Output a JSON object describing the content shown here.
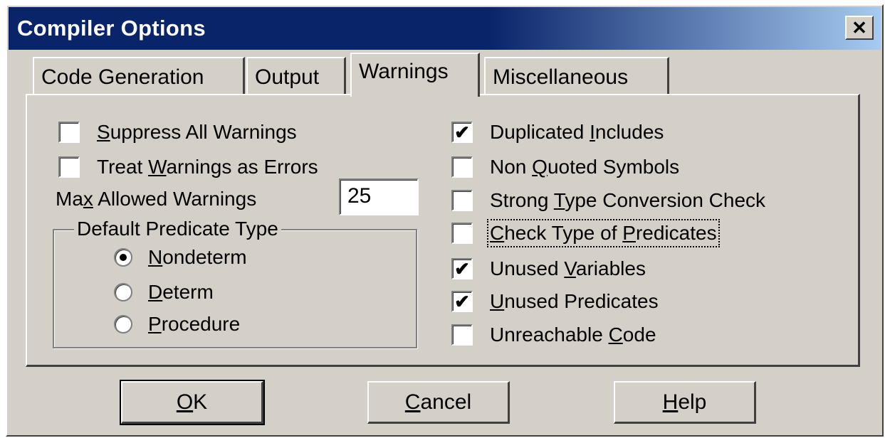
{
  "window": {
    "title": "Compiler Options",
    "close_symbol": "✕"
  },
  "tabs": [
    {
      "label": "Code Generation",
      "active": false
    },
    {
      "label": "Output",
      "active": false
    },
    {
      "label": "Warnings",
      "active": true
    },
    {
      "label": "Miscellaneous",
      "active": false
    }
  ],
  "left_options": {
    "suppress_all": {
      "pre": "",
      "u": "S",
      "post": "uppress All Warnings",
      "checked": false
    },
    "treat_as_errors": {
      "pre": "Treat ",
      "u": "W",
      "post": "arnings as Errors",
      "checked": false
    },
    "max_allowed": {
      "pre": "Ma",
      "u": "x",
      "post": " Allowed Warnings",
      "value": "25"
    }
  },
  "predicate_group": {
    "legend": "Default Predicate Type",
    "options": [
      {
        "u": "N",
        "post": "ondeterm",
        "selected": true
      },
      {
        "u": "D",
        "post": "eterm",
        "selected": false
      },
      {
        "u": "P",
        "post": "rocedure",
        "selected": false
      }
    ]
  },
  "right_options": [
    {
      "pre": "Duplicated ",
      "u": "I",
      "post": "ncludes",
      "checked": true
    },
    {
      "pre": "Non ",
      "u": "Q",
      "post": "uoted Symbols",
      "checked": false
    },
    {
      "pre": "Strong ",
      "u": "T",
      "post": "ype Conversion Check",
      "checked": false
    },
    {
      "pre": "",
      "u": "C",
      "post": "heck Type of ",
      "u2": "P",
      "post2": "redicates",
      "checked": false,
      "focused": true
    },
    {
      "pre": "Unused ",
      "u": "V",
      "post": "ariables",
      "checked": true
    },
    {
      "pre": "",
      "u": "U",
      "post": "nused Predicates",
      "checked": true
    },
    {
      "pre": "Unreachable ",
      "u": "C",
      "post": "ode",
      "checked": false
    }
  ],
  "buttons": {
    "ok": {
      "u": "O",
      "post": "K"
    },
    "cancel": {
      "u": "C",
      "post": "ancel"
    },
    "help": {
      "u": "H",
      "post": "elp"
    }
  },
  "check_mark": "✔",
  "colors": {
    "titlebar": "#0a246a",
    "face": "#d4d0c8"
  }
}
